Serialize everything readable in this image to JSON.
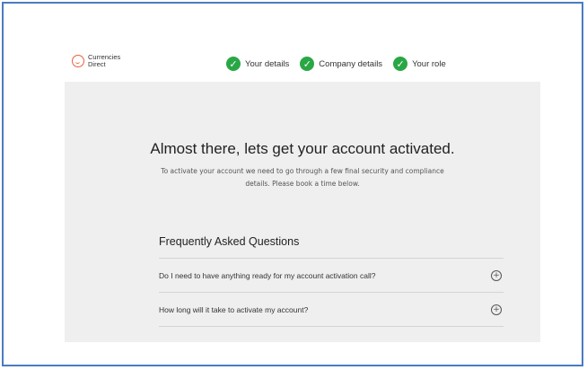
{
  "brand": {
    "name_line1": "Currencies",
    "name_line2": "Direct",
    "accent": "#e8603c"
  },
  "steps": [
    {
      "label": "Your details",
      "status": "complete"
    },
    {
      "label": "Company details",
      "status": "complete"
    },
    {
      "label": "Your role",
      "status": "complete"
    }
  ],
  "step_check_color": "#29a745",
  "main": {
    "title": "Almost there, lets get your account activated.",
    "subtitle": "To activate your account we need to go through a few final security and compliance details. Please book a time below."
  },
  "faq": {
    "title": "Frequently Asked Questions",
    "items": [
      {
        "question": "Do I need to have anything ready for my account activation call?"
      },
      {
        "question": "How long will it take to activate my account?"
      }
    ]
  }
}
